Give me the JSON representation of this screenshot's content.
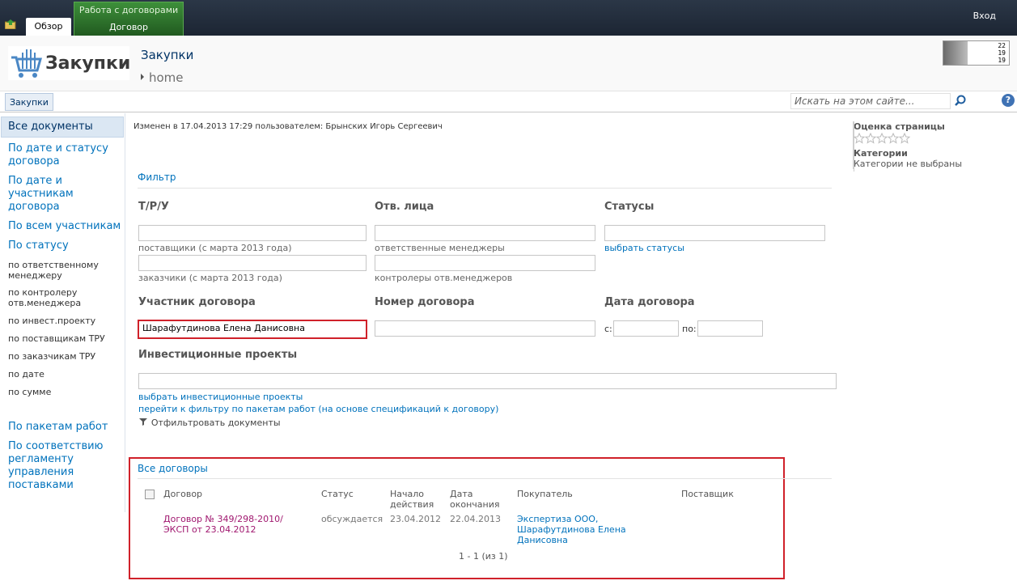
{
  "ribbon": {
    "tab_overview": "Обзор",
    "context_group": "Работа с договорами",
    "context_tab": "Договор",
    "login": "Вход"
  },
  "header": {
    "logo_text": "Закупки",
    "site_title": "Закупки",
    "breadcrumb": "home",
    "stats": [
      "22",
      "19",
      "19"
    ]
  },
  "topnav": {
    "tab": "Закупки",
    "search_placeholder": "Искать на этом сайте..."
  },
  "leftnav": {
    "items": [
      "Все документы",
      "По дате и статусу договора",
      "По дате и участникам договора",
      "По всем участникам",
      "По статусу",
      "по ответственному менеджеру",
      "по контролеру отв.менеджера",
      "по инвест.проекту",
      "по поставщикам ТРУ",
      "по заказчикам ТРУ",
      "по дате",
      "по сумме",
      "По пакетам работ",
      "По соответствию регламенту управления поставками"
    ]
  },
  "main": {
    "modified": "Изменен в 17.04.2013 17:29 пользователем: Брынских Игорь Сергеевич",
    "filter_title": "Фильтр",
    "labels": {
      "tru": "Т/Р/У",
      "responsible": "Отв. лица",
      "statuses": "Статусы",
      "participant": "Участник договора",
      "contract_number": "Номер договора",
      "contract_date": "Дата договора",
      "invest_projects": "Инвестиционные проекты"
    },
    "hints": {
      "suppliers": "поставщики (с марта 2013 года)",
      "customers": "заказчики (с марта 2013 года)",
      "managers": "ответственные менеджеры",
      "controllers": "контролеры отв.менеджеров"
    },
    "links": {
      "choose_statuses": "выбрать статусы",
      "choose_projects": "выбрать инвестиционные проекты",
      "go_packages": "перейти к фильтру по пакетам работ (на основе спецификаций к договору)"
    },
    "participant_value": "Шарафутдинова Елена Данисовна",
    "date_from_label": "с:",
    "date_to_label": "по:",
    "filter_button": "Отфильтровать документы"
  },
  "list": {
    "title": "Все договоры",
    "columns": [
      "Договор",
      "Статус",
      "Начало действия",
      "Дата окончания",
      "Покупатель",
      "Поставщик"
    ],
    "rows": [
      {
        "contract": "Договор № 349/298-2010/ЭКСП от 23.04.2012",
        "status": "обсуждается",
        "start": "23.04.2012",
        "end": "22.04.2013",
        "buyer": "Экспертиза ООО, Шарафутдинова Елена Данисовна",
        "supplier": ""
      }
    ],
    "paging": "1 - 1 (из 1)"
  },
  "right": {
    "rating_title": "Оценка страницы",
    "categories_title": "Категории",
    "categories_text": "Категории не выбраны"
  },
  "colors": {
    "accent_red": "#d0212a",
    "link": "#0072bc",
    "ribbon": "#2b3747",
    "contract_link": "#a0176f"
  }
}
